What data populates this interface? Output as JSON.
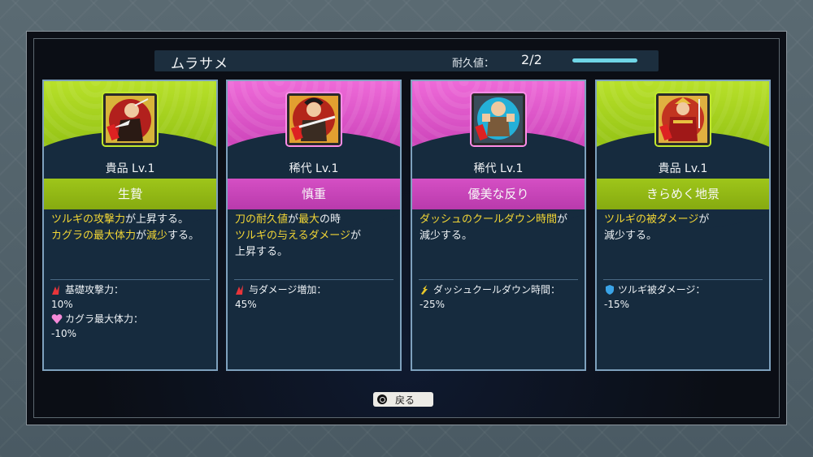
{
  "header": {
    "title": "ムラサメ",
    "durability_label": "耐久値：",
    "durability_value": "2/2",
    "durability_fraction": 1.0
  },
  "colors": {
    "green": "#9ec61a",
    "pink": "#d54fc4",
    "highlight": "#f2d635",
    "card_bg": "#162b3e",
    "card_border": "#7ea1bd"
  },
  "cards": [
    {
      "theme": "green",
      "portrait_icon": "warrior-crimson-portrait-icon",
      "rarity": "貴品 Lv.1",
      "name": "生贄",
      "desc_lines": [
        [
          {
            "t": "ツルギの攻撃力",
            "hl": true
          },
          {
            "t": "が上昇する。",
            "hl": false
          }
        ],
        [
          {
            "t": "カグラの最大体力",
            "hl": true
          },
          {
            "t": "が",
            "hl": false
          },
          {
            "t": "減少",
            "hl": true
          },
          {
            "t": "する。",
            "hl": false
          }
        ]
      ],
      "stats": [
        {
          "icon": "attack-icon",
          "label": "基礎攻撃力：",
          "value": "10%"
        },
        {
          "icon": "heart-icon",
          "label": "カグラ最大体力：",
          "value": "-10%"
        }
      ]
    },
    {
      "theme": "pink",
      "portrait_icon": "swordsman-portrait-icon",
      "rarity": "稀代 Lv.1",
      "name": "慎重",
      "desc_lines": [
        [
          {
            "t": "刀の耐久値",
            "hl": true
          },
          {
            "t": "が",
            "hl": false
          },
          {
            "t": "最大",
            "hl": true
          },
          {
            "t": "の時",
            "hl": false
          }
        ],
        [
          {
            "t": "ツルギの与えるダメージ",
            "hl": true
          },
          {
            "t": "が",
            "hl": false
          }
        ],
        [
          {
            "t": "上昇する。",
            "hl": false
          }
        ]
      ],
      "stats": [
        {
          "icon": "attack-icon",
          "label": "与ダメージ増加：",
          "value": "45%"
        }
      ]
    },
    {
      "theme": "pink",
      "portrait_icon": "brawler-portrait-icon",
      "rarity": "稀代 Lv.1",
      "name": "優美な反り",
      "desc_lines": [
        [
          {
            "t": "ダッシュのクールダウン時間",
            "hl": true
          },
          {
            "t": "が",
            "hl": false
          }
        ],
        [
          {
            "t": "減少する。",
            "hl": false
          }
        ]
      ],
      "stats": [
        {
          "icon": "dash-icon",
          "label": "ダッシュクールダウン時間：",
          "value": "-25%"
        }
      ]
    },
    {
      "theme": "green",
      "portrait_icon": "samurai-armor-portrait-icon",
      "rarity": "貴品 Lv.1",
      "name": "きらめく地景",
      "desc_lines": [
        [
          {
            "t": "ツルギの被ダメージ",
            "hl": true
          },
          {
            "t": "が",
            "hl": false
          }
        ],
        [
          {
            "t": "減少する。",
            "hl": false
          }
        ]
      ],
      "stats": [
        {
          "icon": "shield-icon",
          "label": "ツルギ被ダメージ：",
          "value": "-15%"
        }
      ]
    }
  ],
  "footer": {
    "back_label": "戻る",
    "back_icon": "circle-button-icon"
  }
}
